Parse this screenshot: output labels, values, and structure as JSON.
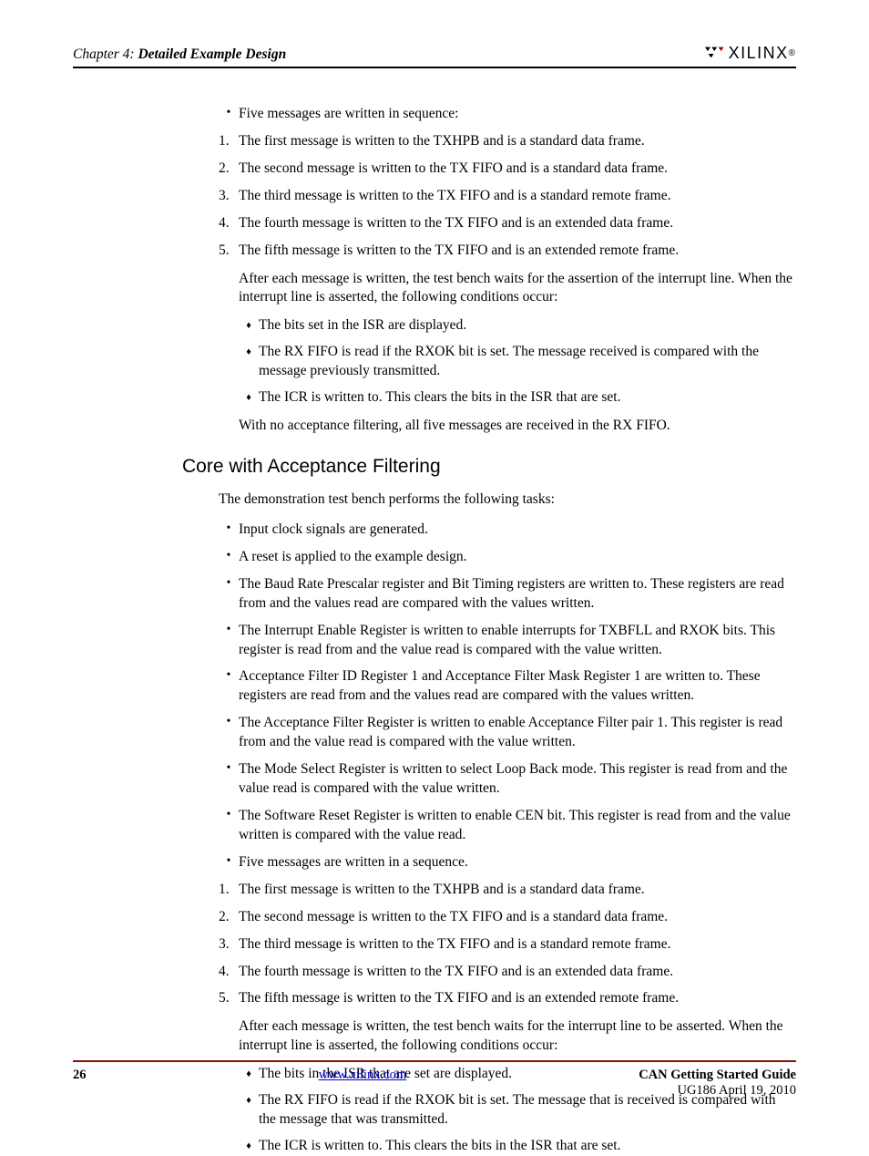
{
  "header": {
    "chapter": "Chapter 4:",
    "title": "Detailed Example Design",
    "logo_text": "XILINX"
  },
  "section1": {
    "b1": "Five messages are written in sequence:",
    "n1": {
      "num": "1.",
      "text": "The first message is written to the TXHPB and is a standard data frame."
    },
    "n2": {
      "num": "2.",
      "text": "The second message is written to the TX FIFO and is a standard data frame."
    },
    "n3": {
      "num": "3.",
      "text": "The third message is written to the TX FIFO and is a standard remote frame."
    },
    "n4": {
      "num": "4.",
      "text": "The fourth message is written to the TX FIFO and is an extended data frame."
    },
    "n5": {
      "num": "5.",
      "text": "The fifth message is written to the TX FIFO and is an extended remote frame."
    },
    "p1": "After each message is written, the test bench waits for the assertion of the interrupt line. When the interrupt line is asserted, the following conditions occur:",
    "d1": "The bits set in the ISR are displayed.",
    "d2": "The RX FIFO is read if the RXOK bit is set. The message received is compared with the message previously transmitted.",
    "d3": "The ICR is written to. This clears the bits in the ISR that are set.",
    "p2": "With no acceptance filtering, all five messages are received in the RX FIFO."
  },
  "section2": {
    "heading": "Core with Acceptance Filtering",
    "intro": "The demonstration test bench performs the following tasks:",
    "b1": "Input clock signals are generated.",
    "b2": "A reset is applied to the example design.",
    "b3": "The Baud Rate Prescalar register and Bit Timing registers are written to. These registers are read from and the values read are compared with the values written.",
    "b4": "The Interrupt Enable Register is written to enable interrupts for TXBFLL and RXOK bits. This register is read from and the value read is compared with the value written.",
    "b5": "Acceptance Filter ID Register 1 and Acceptance Filter Mask Register 1 are written to. These registers are read from and the values read are compared with the values written.",
    "b6": "The Acceptance Filter Register  is written to enable Acceptance Filter pair 1. This register is read from and the value read is compared with the value written.",
    "b7": "The Mode Select Register is written to select Loop Back mode. This register is read from and the value read is compared with the value written.",
    "b8": "The Software Reset Register is written to enable CEN bit. This register is read from and the value written is compared with the value read.",
    "b9": "Five messages are written in a sequence.",
    "n1": {
      "num": "1.",
      "text": "The first message is written to the TXHPB and is a standard data frame."
    },
    "n2": {
      "num": "2.",
      "text": "The second message is written to the TX FIFO and is a standard data frame."
    },
    "n3": {
      "num": "3.",
      "text": "The third message is written to the TX FIFO and is a standard remote frame."
    },
    "n4": {
      "num": "4.",
      "text": "The fourth message is written to the TX FIFO and is an extended data frame."
    },
    "n5": {
      "num": "5.",
      "text": "The fifth message is written to the TX FIFO and is an extended remote frame."
    },
    "p1": "After each message is written, the test bench waits for the interrupt line to be asserted. When the interrupt line is asserted, the following conditions occur:",
    "d1": "The bits in the ISR that are set are displayed.",
    "d2": "The RX FIFO is read if the RXOK bit is set. The message that is received is compared with the message that was transmitted.",
    "d3": "The ICR is written to. This clears the bits in the ISR that are set."
  },
  "footer": {
    "page": "26",
    "link": "www.xilinx.com",
    "title": "CAN Getting Started Guide",
    "sub": "UG186 April 19, 2010"
  }
}
